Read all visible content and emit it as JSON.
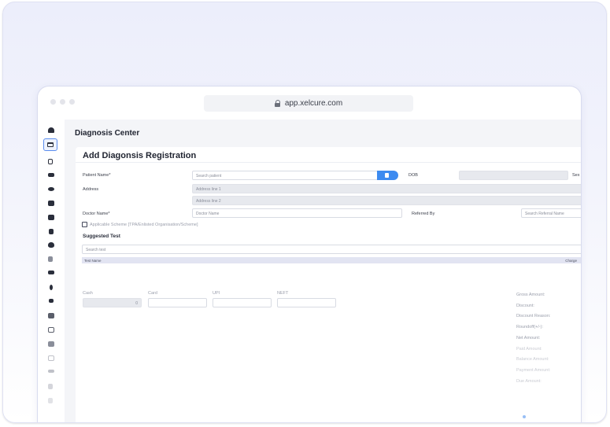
{
  "browser": {
    "url": "app.xelcure.com"
  },
  "header": {
    "title": "Diagnosis Center"
  },
  "form": {
    "title": "Add Diagonsis Registration",
    "patient_label": "Patient Name*",
    "patient_placeholder": "Search patient",
    "dob_label": "DOB",
    "sex_label": "Sex",
    "address_label": "Address",
    "address_line1": "Address line 1",
    "address_line2": "Address line 2",
    "doctor_label": "Doctor Name*",
    "doctor_placeholder": "Doctor Name",
    "referred_label": "Referred By",
    "referral_placeholder": "Search Referral Name",
    "scheme_label": "Applicable Scheme [TPA/Enlisted Organisation/Scheme]",
    "suggested_title": "Suggested Test",
    "search_test_placeholder": "Search test",
    "table_headers": [
      "Test Name",
      "Charge"
    ]
  },
  "payment": {
    "cash_label": "Cash",
    "card_label": "Card",
    "upi_label": "UPI",
    "neft_label": "NEFT",
    "cash_value": "0"
  },
  "summary": {
    "rows": [
      "Gross Amount:",
      "Discount:",
      "Discount Reason:",
      "Roundoff(+/-):",
      "Net Amount:",
      "Paid Amount:",
      "Balance Amount:",
      "Payment Amount:",
      "Due Amount:"
    ]
  },
  "icons": [
    "home-icon",
    "monitor-icon",
    "copy-icon",
    "bed-icon",
    "eye-icon",
    "id-card-icon",
    "camera-icon",
    "user-icon",
    "heart-icon",
    "scissors-icon",
    "bed-alt-icon",
    "pin-icon",
    "drip-icon",
    "printer-icon",
    "grid-icon",
    "database-icon",
    "card-icon",
    "list-icon",
    "undo-icon",
    "check-icon"
  ]
}
